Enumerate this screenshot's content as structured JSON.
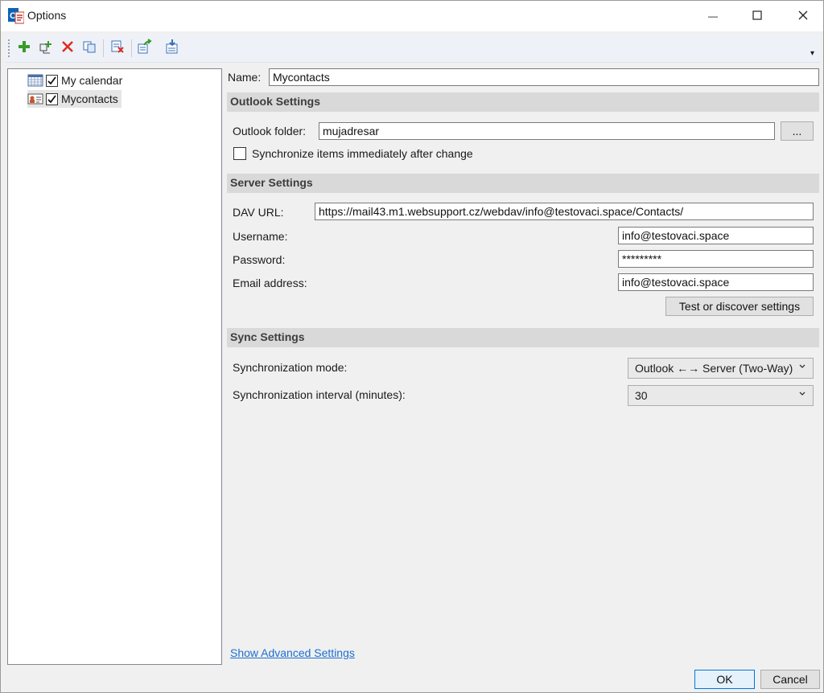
{
  "window": {
    "title": "Options"
  },
  "titlebar": {
    "minimize_glyph": "—",
    "maximize_glyph": "☐",
    "close_glyph": "✕"
  },
  "toolbar": {
    "buttons": [
      {
        "icon": "add-icon"
      },
      {
        "icon": "add-multiple-icon"
      },
      {
        "icon": "delete-icon"
      },
      {
        "icon": "copy-icon"
      },
      {
        "icon": "clear-cache-icon"
      },
      {
        "icon": "export-icon"
      },
      {
        "icon": "import-icon"
      }
    ],
    "overflow_glyph": "▾"
  },
  "tree": {
    "items": [
      {
        "label": "My calendar",
        "icon": "calendar-icon",
        "checked": true,
        "selected": false
      },
      {
        "label": "Mycontacts",
        "icon": "contacts-icon",
        "checked": true,
        "selected": true
      }
    ]
  },
  "form": {
    "name_label": "Name:",
    "name_value": "Mycontacts",
    "outlook_section": "Outlook Settings",
    "outlook_folder_label": "Outlook folder:",
    "outlook_folder_value": "mujadresar",
    "browse_label": "...",
    "sync_immediately_label": "Synchronize items immediately after change",
    "sync_immediately_checked": false,
    "server_section": "Server Settings",
    "dav_url_label": "DAV URL:",
    "dav_url_value": "https://mail43.m1.websupport.cz/webdav/info@testovaci.space/Contacts/",
    "username_label": "Username:",
    "username_value": "info@testovaci.space",
    "password_label": "Password:",
    "password_value": "*********",
    "email_label": "Email address:",
    "email_value": "info@testovaci.space",
    "test_button_label": "Test or discover settings",
    "sync_section": "Sync Settings",
    "sync_mode_label": "Synchronization mode:",
    "sync_mode_value": "Outlook ←→ Server (Two-Way)",
    "sync_interval_label": "Synchronization interval (minutes):",
    "sync_interval_value": "30",
    "advanced_link": "Show Advanced Settings"
  },
  "footer": {
    "ok_label": "OK",
    "cancel_label": "Cancel"
  },
  "colors": {
    "link": "#1e6fd0",
    "section_bg": "#d9d9d9",
    "toolbar_bg": "#eef2f8",
    "ok_border": "#0078d7"
  }
}
